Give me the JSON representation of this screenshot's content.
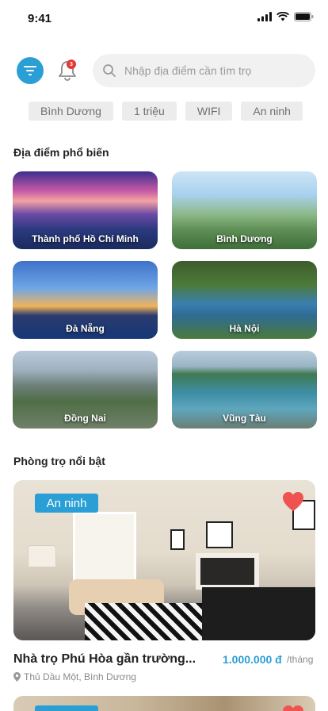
{
  "status_bar": {
    "time": "9:41"
  },
  "header": {
    "notification_count": "3",
    "search_placeholder": "Nhập địa điểm cần tìm trọ"
  },
  "chips": [
    "Bình Dương",
    "1 triệu",
    "WIFI",
    "An ninh"
  ],
  "popular_section": {
    "title": "Địa điểm phổ biến",
    "places": [
      {
        "name": "Thành phố Hồ Chí Minh"
      },
      {
        "name": "Bình Dương"
      },
      {
        "name": "Đà Nẵng"
      },
      {
        "name": "Hà Nội"
      },
      {
        "name": "Đồng Nai"
      },
      {
        "name": "Vũng Tàu"
      }
    ]
  },
  "featured_section": {
    "title": "Phòng trọ nổi bật",
    "listings": [
      {
        "badge": "An ninh",
        "title": "Nhà trọ Phú Hòa gần trường...",
        "price": "1.000.000 đ",
        "price_unit": "/tháng",
        "location": "Thủ Dầu Một, Bình Dương"
      }
    ]
  },
  "colors": {
    "accent": "#2a9fd6",
    "heart": "#ef5350",
    "badge_red": "#e53935"
  },
  "icons": [
    "filter-icon",
    "bell-icon",
    "search-icon",
    "heart-icon",
    "location-pin-icon",
    "signal-icon",
    "wifi-icon",
    "battery-icon"
  ]
}
